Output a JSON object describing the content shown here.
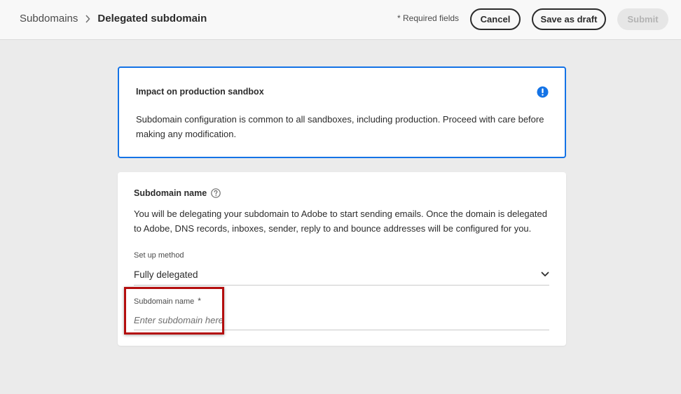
{
  "header": {
    "breadcrumb": {
      "parent": "Subdomains",
      "current": "Delegated subdomain"
    },
    "required_note": "* Required fields",
    "buttons": {
      "cancel": "Cancel",
      "save_draft": "Save as draft",
      "submit": "Submit"
    }
  },
  "alert": {
    "title": "Impact on production sandbox",
    "body": "Subdomain configuration is common to all sandboxes, including production. Proceed with care before making any modification.",
    "icon": "info-icon",
    "accent_color": "#1473e6"
  },
  "card": {
    "title": "Subdomain name",
    "description": "You will be delegating your subdomain to Adobe to start sending emails. Once the domain is delegated to Adobe, DNS records, inboxes, sender, reply to and bounce addresses will be configured for you.",
    "setup_method": {
      "label": "Set up method",
      "value": "Fully delegated"
    },
    "subdomain_field": {
      "label": "Subdomain name",
      "required_marker": "*",
      "placeholder": "Enter subdomain here",
      "value": ""
    }
  },
  "annotation": {
    "highlight_color": "#b40e0e"
  }
}
